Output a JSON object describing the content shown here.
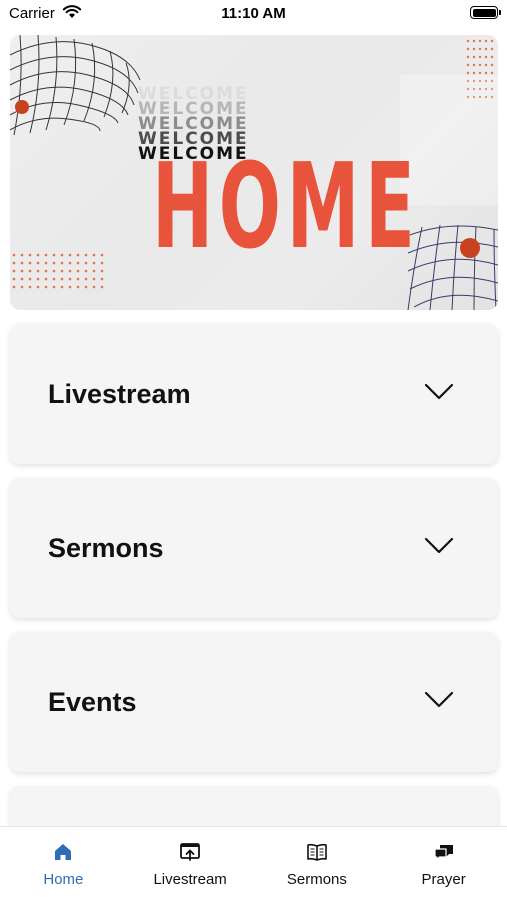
{
  "status_bar": {
    "carrier": "Carrier",
    "time": "11:10 AM"
  },
  "banner": {
    "welcome_lines": [
      "WELCOME",
      "WELCOME",
      "WELCOME",
      "WELCOME",
      "WELCOME"
    ],
    "title": "HOME",
    "accent_color": "#e8543b"
  },
  "sections": [
    {
      "label": "Livestream",
      "icon": "chevron-down-icon"
    },
    {
      "label": "Sermons",
      "icon": "chevron-down-icon"
    },
    {
      "label": "Events",
      "icon": "chevron-down-icon"
    }
  ],
  "tab_bar": {
    "active_color": "#2f6db5",
    "tabs": [
      {
        "label": "Home",
        "icon": "home-icon",
        "active": true
      },
      {
        "label": "Livestream",
        "icon": "livestream-icon",
        "active": false
      },
      {
        "label": "Sermons",
        "icon": "book-icon",
        "active": false
      },
      {
        "label": "Prayer",
        "icon": "chat-bubbles-icon",
        "active": false
      }
    ]
  }
}
